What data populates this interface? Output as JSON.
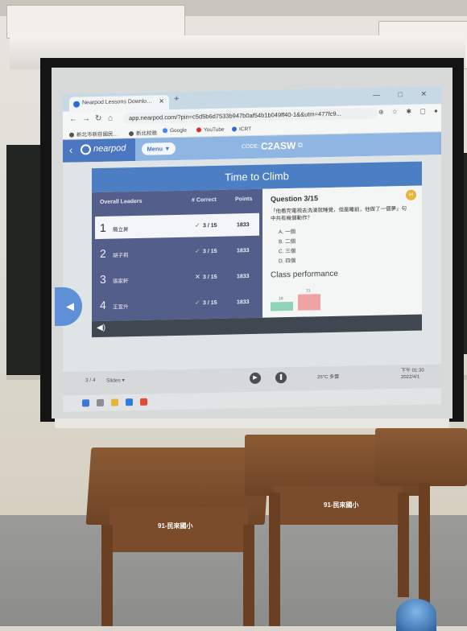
{
  "browser": {
    "tab_title": "Nearpod Lessons Downlo…",
    "new_tab": "+",
    "window_controls": "—  □  ✕",
    "url": "app.nearpod.com/?pin=c5d5b6d7533b947b0af54b1b049ff40-1&&utm=477fc9...",
    "bookmarks": [
      "新北市新莊國民… ",
      "新北校務",
      "Google",
      "YouTube",
      "ICRT"
    ]
  },
  "nearpod": {
    "logo": "nearpod",
    "menu_button": "Menu ▼",
    "code_label": "CODE:",
    "code": "C2ASW",
    "activity_title": "Time to Climb",
    "leaders_header": "Overall Leaders",
    "correct_header": "# Correct",
    "points_header": "Points",
    "leaders": [
      {
        "rank": "1",
        "name": "簡立昇",
        "mark": "✓",
        "score": "3 / 15",
        "points": "1833"
      },
      {
        "rank": "2",
        "name": "胡子莉",
        "mark": "✓",
        "score": "3 / 15",
        "points": "1833"
      },
      {
        "rank": "3",
        "name": "張家軒",
        "mark": "✕",
        "score": "3 / 15",
        "points": "1833"
      },
      {
        "rank": "4",
        "name": "王宣升",
        "mark": "✓",
        "score": "3 / 15",
        "points": "1833"
      }
    ],
    "question_number": "Question 3/15",
    "question_badge": "H",
    "question_text": "「他看完電視去洗澡就睡覺，但是睡前，他做了一個夢」句中共有幾個動作？",
    "options": [
      "A. 一個",
      "B. 二個",
      "C. 三個",
      "D. 四個"
    ],
    "class_performance": "Class performance",
    "performance_bars": [
      {
        "label": "18",
        "value": 0.55,
        "color": "#8fd3b8"
      },
      {
        "label": "31",
        "value": 1.0,
        "color": "#f0a3a3"
      }
    ]
  },
  "taskbar": {
    "page": "3 / 4",
    "slides_label": "Slides ▾",
    "weather": "25°C 多雲",
    "clock": [
      "下午 01:30",
      "2022/4/1"
    ]
  },
  "desks": {
    "plate_left": "91-民來國小",
    "plate_middle": "91-民來國小"
  },
  "colors": {
    "nearpod_blue": "#4a77bf",
    "title_bar": "#4c7ec4",
    "leaders_bg": "#545e8a",
    "wood": "#7a4c2c"
  }
}
